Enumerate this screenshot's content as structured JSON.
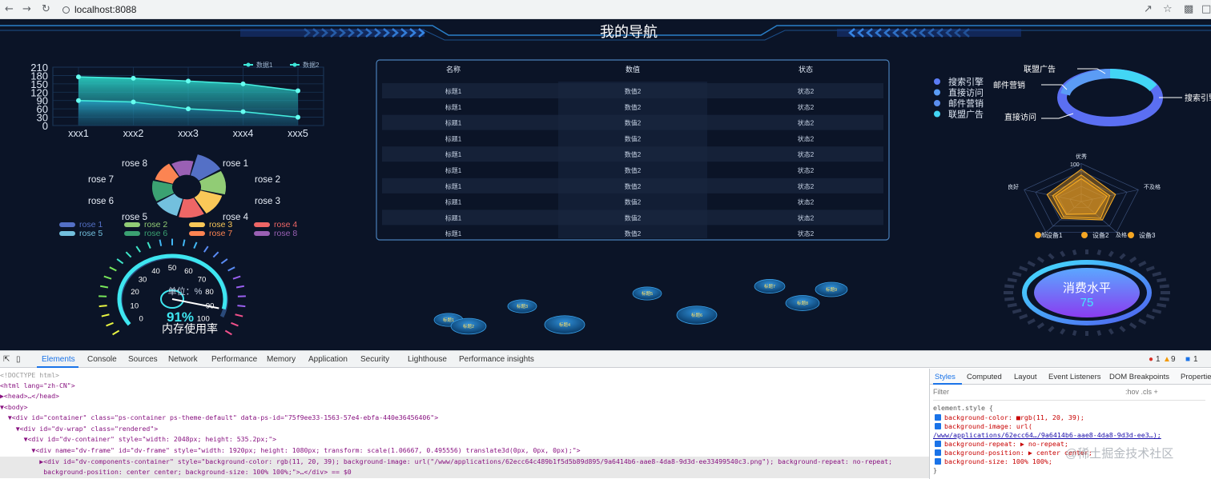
{
  "browser": {
    "url": "localhost:8088",
    "back_icon": "arrow-left-icon",
    "forward_icon": "arrow-right-icon",
    "reload_icon": "reload-icon"
  },
  "dashboard": {
    "title": "我的导航",
    "line_chart": {
      "type": "area",
      "categories": [
        "xxx1",
        "xxx2",
        "xxx3",
        "xxx4",
        "xxx5"
      ],
      "y_ticks": [
        "0",
        "30",
        "60",
        "90",
        "120",
        "150",
        "180",
        "210"
      ],
      "legend": [
        "数据1",
        "数据2"
      ],
      "series": [
        {
          "name": "数据1",
          "values": [
            175,
            170,
            160,
            150,
            125
          ]
        },
        {
          "name": "数据2",
          "values": [
            90,
            85,
            60,
            50,
            30
          ]
        }
      ],
      "ylim": [
        0,
        210
      ]
    },
    "rose_chart": {
      "type": "pie",
      "labels": [
        "rose 1",
        "rose 2",
        "rose 3",
        "rose 4",
        "rose 5",
        "rose 6",
        "rose 7",
        "rose 8"
      ],
      "values": [
        40,
        38,
        32,
        30,
        28,
        26,
        22,
        18
      ],
      "colors": [
        "#5470c6",
        "#91cc75",
        "#fac858",
        "#ee6666",
        "#73c0de",
        "#3ba272",
        "#fc8452",
        "#9a60b4"
      ]
    },
    "table": {
      "headers": [
        "名称",
        "数值",
        "状态"
      ],
      "rows": [
        [
          "标题1",
          "数值2",
          "状态2"
        ],
        [
          "标题1",
          "数值2",
          "状态2"
        ],
        [
          "标题1",
          "数值2",
          "状态2"
        ],
        [
          "标题1",
          "数值2",
          "状态2"
        ],
        [
          "标题1",
          "数值2",
          "状态2"
        ],
        [
          "标题1",
          "数值2",
          "状态2"
        ],
        [
          "标题1",
          "数值2",
          "状态2"
        ],
        [
          "标题1",
          "数值2",
          "状态2"
        ],
        [
          "标题1",
          "数值2",
          "状态2"
        ],
        [
          "标题1",
          "数值2",
          "状态2"
        ]
      ]
    },
    "donut_chart": {
      "legend": [
        "搜索引擎",
        "直接访问",
        "邮件营销",
        "联盟广告"
      ],
      "colors": [
        "#5b7cf5",
        "#5b9cf5",
        "#5b8ef0",
        "#42d6f5"
      ],
      "callouts": [
        "联盟广告",
        "邮件营销",
        "搜索引擎",
        "直接访问"
      ]
    },
    "radar_chart": {
      "indicators": [
        "优秀",
        "不及格",
        "及格",
        "一般",
        "良好"
      ],
      "tick": "100",
      "legend": [
        "设备1",
        "设备2",
        "设备3"
      ]
    },
    "gauge": {
      "value_text": "91%",
      "value": 91,
      "unit_label": "单位：%",
      "caption": "内存使用率",
      "ticks": [
        "0",
        "10",
        "20",
        "30",
        "40",
        "50",
        "60",
        "70",
        "80",
        "90",
        "100"
      ]
    },
    "bubbles": [
      "标题1",
      "标题2",
      "标题3",
      "标题4",
      "标题5",
      "标题6",
      "标题7",
      "标题8",
      "标题9",
      "标题10"
    ],
    "consumption": {
      "label": "消费水平",
      "value": "75"
    }
  },
  "devtools": {
    "tabs": [
      "Elements",
      "Console",
      "Sources",
      "Network",
      "Performance",
      "Memory",
      "Application",
      "Security",
      "Lighthouse",
      "Performance insights"
    ],
    "badges": {
      "errors": "1",
      "warnings": "9",
      "info": "1"
    },
    "dom_lines": [
      "<!DOCTYPE html>",
      "<html lang=\"zh-CN\">",
      "▶<head>…</head>",
      "▼<body>",
      "  ▼<div id=\"container\" class=\"ps-container ps-theme-default\" data-ps-id=\"75f9ee33-1563-57e4-ebfa-440e36456406\">",
      "    ▼<div id=\"dv-wrap\" class=\"rendered\">",
      "      ▼<div id=\"dv-container\" style=\"width: 2048px; height: 535.2px;\">",
      "        ▼<div name=\"dv-frame\" id=\"dv-frame\" style=\"width: 1920px; height: 1080px; transform: scale(1.06667, 0.495556) translate3d(0px, 0px, 0px);\">",
      "          ▶<div id=\"dv-components-container\" style=\"background-color: rgb(11, 20, 39); background-image: url(\"/www/applications/62ecc64c489b1f5d5b89d895/9a6414b6-aae8-4da8-9d3d-ee33499540c3.png\"); background-repeat: no-repeat;",
      "           background-position: center center; background-size: 100% 100%;\">…</div> == $0"
    ],
    "styles_tabs": [
      "Styles",
      "Computed",
      "Layout",
      "Event Listeners",
      "DOM Breakpoints",
      "Properties"
    ],
    "filter_placeholder": "Filter",
    "filter_tools": ":hov  .cls  +",
    "style_lines": [
      "element.style {",
      "background-color: ■rgb(11, 20, 39);",
      "background-image: url(",
      "/www/applications/62ecc64…/9a6414b6-aae8-4da8-9d3d-ee3…);",
      "background-repeat: ▶ no-repeat;",
      "background-position: ▶ center center;",
      "background-size: 100% 100%;",
      "}"
    ]
  },
  "watermark": "@稀土掘金技术社区"
}
